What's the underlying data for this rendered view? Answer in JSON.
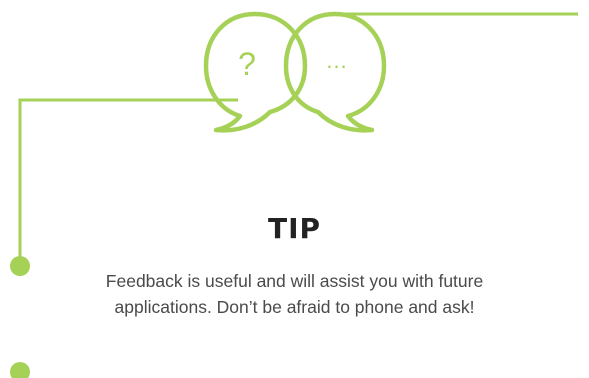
{
  "tip": {
    "heading": "TIP",
    "body_line_1": "Feedback is useful and will assist you with future",
    "body_line_2": "applications. Don’t be afraid to phone and ask!"
  },
  "bubbles": {
    "left_glyph": "?",
    "right_glyph": "..."
  },
  "icons": [
    "question-speech-bubble-icon",
    "ellipsis-speech-bubble-icon"
  ],
  "colors": {
    "accent": "#a6d157",
    "heading": "#222222",
    "body": "#4a4a4a",
    "background": "#ffffff"
  }
}
